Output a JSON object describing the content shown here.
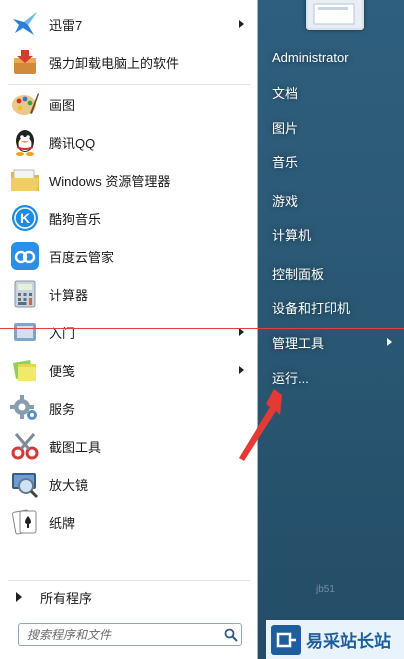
{
  "pinned": [
    {
      "label": "迅雷7",
      "icon": "xunlei-bird-icon",
      "has_submenu": true
    },
    {
      "label": "强力卸载电脑上的软件",
      "icon": "uninstall-box-icon",
      "has_submenu": false
    }
  ],
  "recent": [
    {
      "label": "画图",
      "icon": "paint-palette-icon",
      "has_submenu": false
    },
    {
      "label": "腾讯QQ",
      "icon": "qq-penguin-icon",
      "has_submenu": false
    },
    {
      "label": "Windows 资源管理器",
      "icon": "folder-explorer-icon",
      "has_submenu": false
    },
    {
      "label": "酷狗音乐",
      "icon": "kugou-k-icon",
      "has_submenu": false
    },
    {
      "label": "百度云管家",
      "icon": "baidu-cloud-icon",
      "has_submenu": false
    },
    {
      "label": "计算器",
      "icon": "calculator-icon",
      "has_submenu": false
    },
    {
      "label": "入门",
      "icon": "getting-started-icon",
      "has_submenu": true
    },
    {
      "label": "便笺",
      "icon": "sticky-notes-icon",
      "has_submenu": true
    },
    {
      "label": "服务",
      "icon": "services-gear-icon",
      "has_submenu": false
    },
    {
      "label": "截图工具",
      "icon": "snipping-scissors-icon",
      "has_submenu": false
    },
    {
      "label": "放大镜",
      "icon": "magnifier-icon",
      "has_submenu": false
    },
    {
      "label": "纸牌",
      "icon": "solitaire-card-icon",
      "has_submenu": false
    }
  ],
  "all_programs_label": "所有程序",
  "search": {
    "placeholder": "搜索程序和文件"
  },
  "right_items": [
    {
      "label": "Administrator",
      "has_submenu": false
    },
    {
      "label": "文档",
      "has_submenu": false
    },
    {
      "label": "图片",
      "has_submenu": false
    },
    {
      "label": "音乐",
      "has_submenu": false
    },
    {
      "label": "游戏",
      "has_submenu": false
    },
    {
      "label": "计算机",
      "has_submenu": false
    },
    {
      "label": "控制面板",
      "has_submenu": false
    },
    {
      "label": "设备和打印机",
      "has_submenu": false
    },
    {
      "label": "管理工具",
      "has_submenu": true
    },
    {
      "label": "运行...",
      "has_submenu": false
    }
  ],
  "watermark": {
    "text": "易采站长站",
    "faint": "jb51"
  },
  "colors": {
    "annotation_red": "#e53935",
    "watermark_blue": "#1f5e9c"
  }
}
